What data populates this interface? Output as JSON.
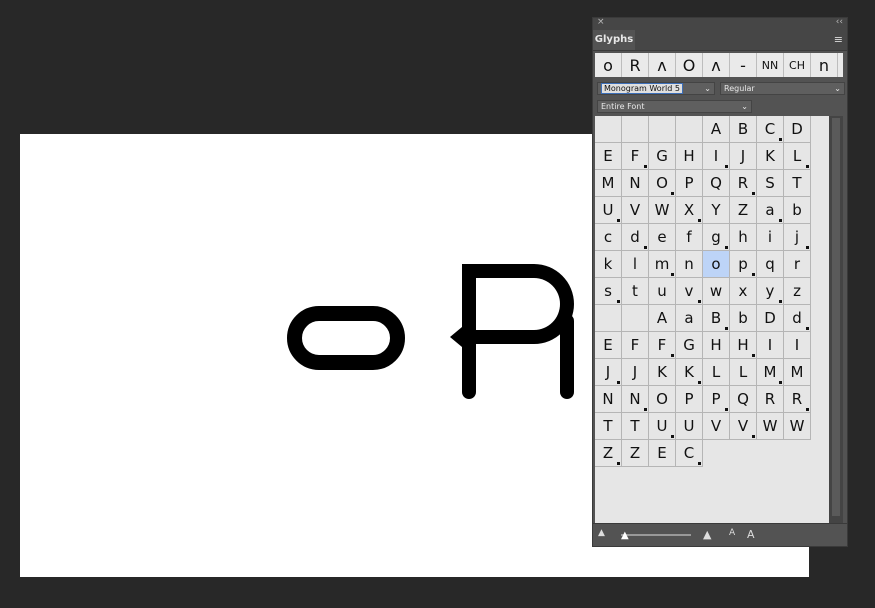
{
  "panel": {
    "close_glyph": "×",
    "collapse_glyph": "‹‹",
    "tab_label": "Glyphs",
    "menu_glyph": "≡"
  },
  "recent_glyphs": [
    "o",
    "R",
    "ᴧ",
    "O",
    "ᴧ",
    "-",
    "NN",
    "CH",
    "n"
  ],
  "font_family": "Monogram World 5",
  "font_style": "Regular",
  "glyph_set": "Entire Font",
  "glyph_grid": [
    "",
    "",
    "",
    "",
    "A",
    "B",
    "C",
    "D",
    "E",
    "F",
    "G",
    "H",
    "I",
    "J",
    "K",
    "L",
    "M",
    "N",
    "O",
    "P",
    "Q",
    "R",
    "S",
    "T",
    "U",
    "V",
    "W",
    "X",
    "Y",
    "Z",
    "a",
    "b",
    "c",
    "d",
    "e",
    "f",
    "g",
    "h",
    "i",
    "j",
    "k",
    "l",
    "m",
    "n",
    "o",
    "p",
    "q",
    "r",
    "s",
    "t",
    "u",
    "v",
    "w",
    "x",
    "y",
    "z",
    "",
    "",
    "A",
    "a",
    "B",
    "b",
    "D",
    "d",
    "E",
    "F",
    "F",
    "G",
    "H",
    "H",
    "I",
    "I",
    "J",
    "J",
    "K",
    "K",
    "L",
    "L",
    "M",
    "M",
    "N",
    "N",
    "O",
    "P",
    "P",
    "Q",
    "R",
    "R",
    "T",
    "T",
    "U",
    "U",
    "V",
    "V",
    "W",
    "W",
    "Z",
    "Z",
    "E",
    "C"
  ],
  "selected_glyph_index": 44,
  "footer": {
    "small_mountain": "▲",
    "large_mountain": "▲",
    "zoom_out": "A",
    "zoom_in": "A"
  },
  "canvas_text": "oR"
}
